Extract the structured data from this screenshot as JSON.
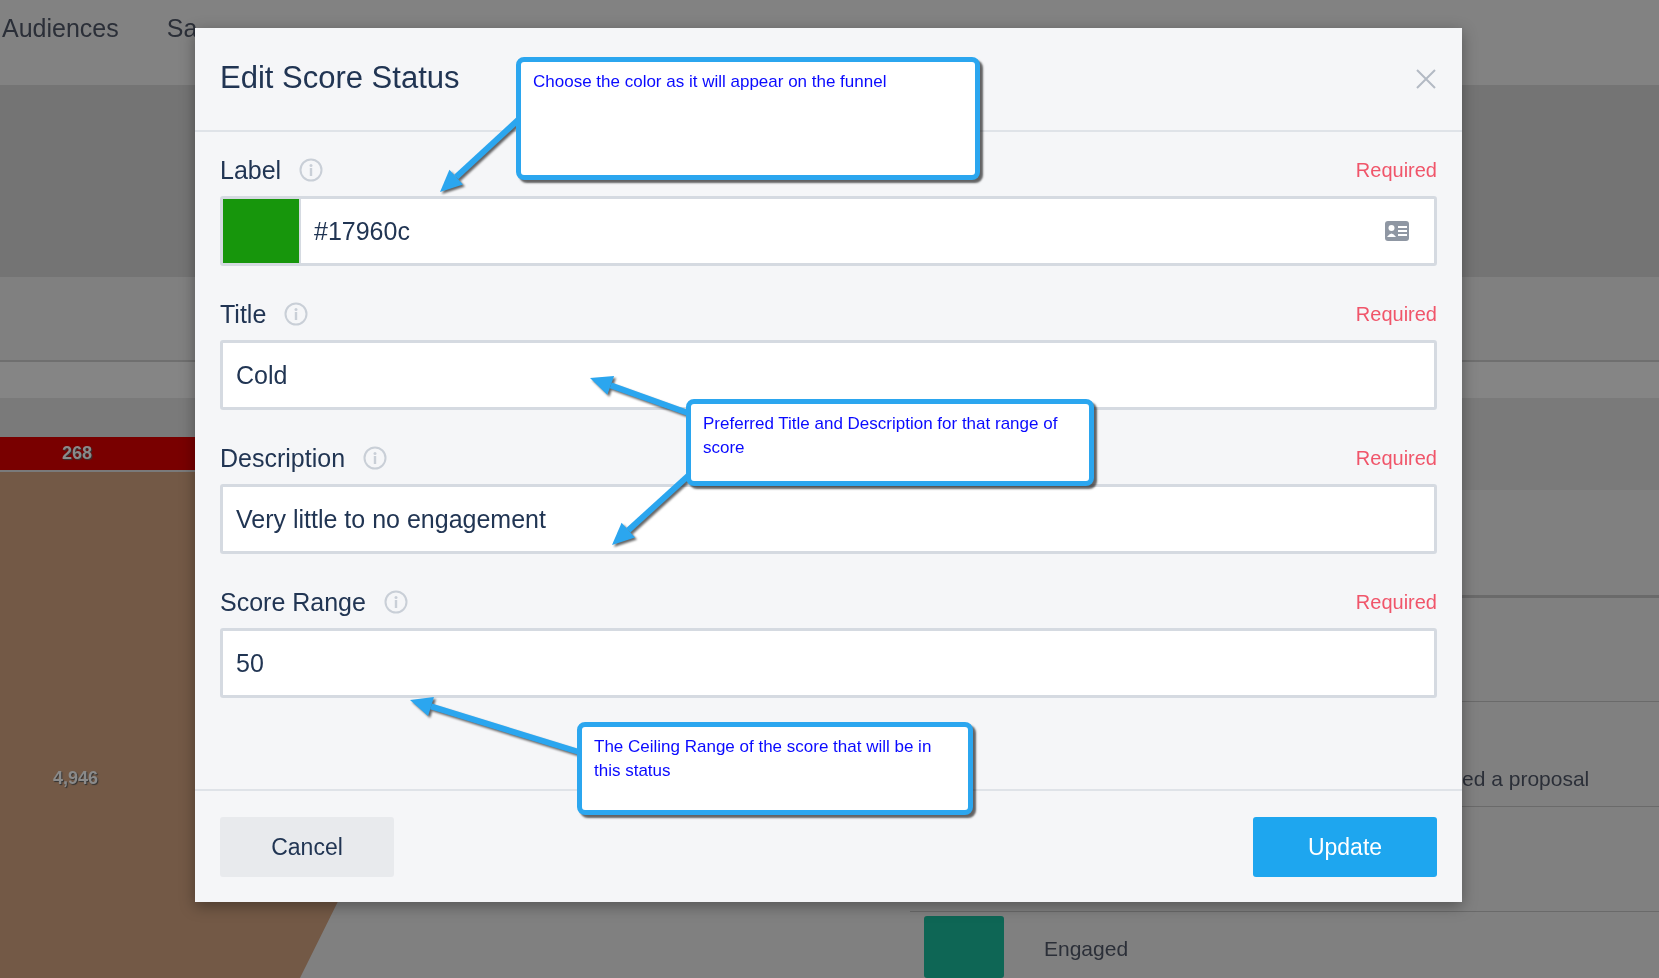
{
  "background": {
    "nav_tabs": [
      "Audiences",
      "Sa"
    ],
    "funnel": {
      "top_value": "268",
      "bottom_value": "4,946"
    },
    "list_items": [
      {
        "text": "ed a proposal"
      },
      {
        "text": "Engaged",
        "color": "#0e6655"
      }
    ]
  },
  "dialog": {
    "title": "Edit Score Status",
    "fields": [
      {
        "kind": "color",
        "label": "Label",
        "required": "Required",
        "value": "#17960c",
        "color": "#17960c"
      },
      {
        "kind": "text",
        "label": "Title",
        "required": "Required",
        "value": "Cold"
      },
      {
        "kind": "text",
        "label": "Description",
        "required": "Required",
        "value": "Very little to no engagement"
      },
      {
        "kind": "text",
        "label": "Score Range",
        "required": "Required",
        "value": "50"
      }
    ],
    "buttons": {
      "cancel": "Cancel",
      "update": "Update"
    }
  },
  "annotations": [
    {
      "text": "Choose the color as it will appear on the funnel"
    },
    {
      "text": "Preferred Title and Description for that range of score"
    },
    {
      "text": "The Ceiling Range of the score that will be in this status"
    }
  ]
}
